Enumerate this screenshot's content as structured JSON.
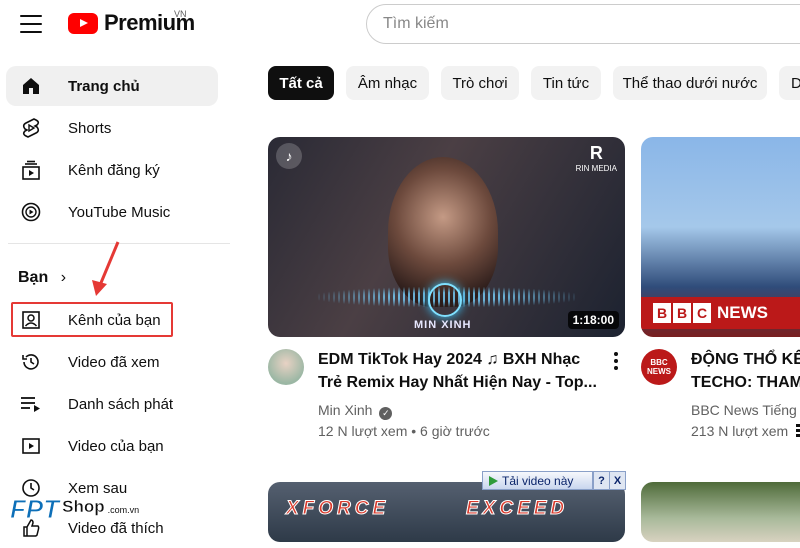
{
  "header": {
    "logo_text": "Premium",
    "country_code": "VN",
    "search_placeholder": "Tìm kiếm"
  },
  "sidebar": {
    "items": [
      {
        "label": "Trang chủ",
        "icon": "home-icon"
      },
      {
        "label": "Shorts",
        "icon": "shorts-icon"
      },
      {
        "label": "Kênh đăng ký",
        "icon": "subscriptions-icon"
      },
      {
        "label": "YouTube Music",
        "icon": "youtube-music-icon"
      }
    ],
    "you_heading": "Bạn",
    "you_items": [
      {
        "label": "Kênh của bạn",
        "icon": "channel-icon"
      },
      {
        "label": "Video đã xem",
        "icon": "history-icon"
      },
      {
        "label": "Danh sách phát",
        "icon": "playlist-icon"
      },
      {
        "label": "Video của bạn",
        "icon": "your-videos-icon"
      },
      {
        "label": "Xem sau",
        "icon": "watch-later-icon"
      },
      {
        "label": "Video đã thích",
        "icon": "liked-videos-icon"
      }
    ]
  },
  "chips": [
    "Tất cả",
    "Âm nhạc",
    "Trò chơi",
    "Tin tức",
    "Thể thao dưới nước",
    "D"
  ],
  "videos": [
    {
      "title_line1": "EDM TikTok Hay 2024 ♫ BXH Nhạc",
      "title_line2": "Trẻ Remix Hay Nhất Hiện Nay - Top...",
      "channel": "Min Xinh",
      "verified": true,
      "meta": "12 N lượt xem • 6 giờ trước",
      "duration": "1:18:00",
      "thumb_brand": "MIN XINH",
      "thumb_corner": "RIN MEDIA"
    },
    {
      "title_line1": "ĐỘNG THỔ KÊ",
      "title_line2": "TECHO: THAM",
      "channel": "BBC News Tiếng",
      "meta": "213 N lượt xem",
      "thumb_banner": "NEWS",
      "avatar_text_1": "BBC",
      "avatar_text_2": "NEWS"
    },
    {
      "thumb_text_1": "XFORCE",
      "thumb_text_2": "EXCEED"
    }
  ],
  "overlay": {
    "download_label": "Tải video này",
    "help": "?",
    "close": "X"
  },
  "watermark": {
    "brand": "FPT",
    "shop": "Shop",
    "domain": ".com.vn"
  },
  "colors": {
    "youtube_red": "#ff0000",
    "annotation_red": "#e53935",
    "bbc_red": "#bb1919"
  }
}
